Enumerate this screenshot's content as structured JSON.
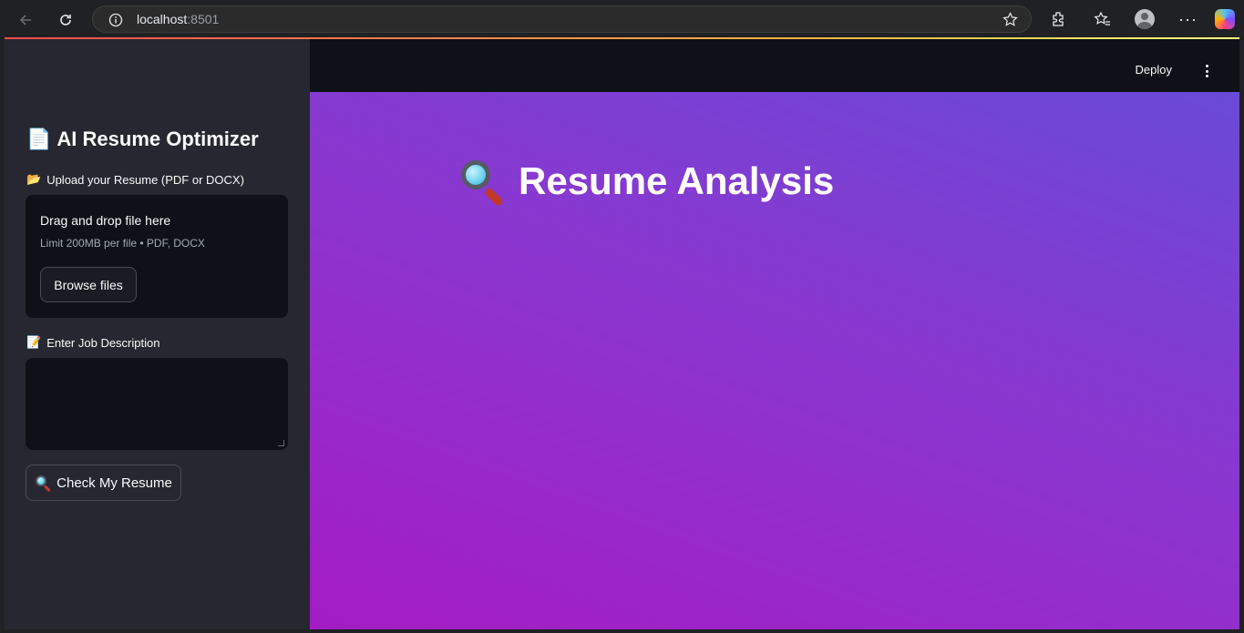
{
  "browser": {
    "url_host": "localhost",
    "url_port": ":8501"
  },
  "header": {
    "deploy_label": "Deploy"
  },
  "sidebar": {
    "title_emoji": "📄",
    "title": "AI Resume Optimizer",
    "upload": {
      "label_emoji": "📂",
      "label": "Upload your Resume (PDF or DOCX)",
      "drag_text": "Drag and drop file here",
      "limit_text": "Limit 200MB per file • PDF, DOCX",
      "browse_label": "Browse files"
    },
    "job_description": {
      "label_emoji": "📝",
      "label": "Enter Job Description",
      "value": ""
    },
    "check_button": {
      "label": "Check My Resume",
      "icon": "magnifier-icon"
    }
  },
  "main": {
    "title": "Resume Analysis",
    "title_icon": "magnifier-icon"
  },
  "colors": {
    "sidebar_bg": "#262730",
    "topbar_bg": "#0e1117",
    "gradient_start": "#6a4ad6",
    "gradient_end": "#a41cc4"
  }
}
